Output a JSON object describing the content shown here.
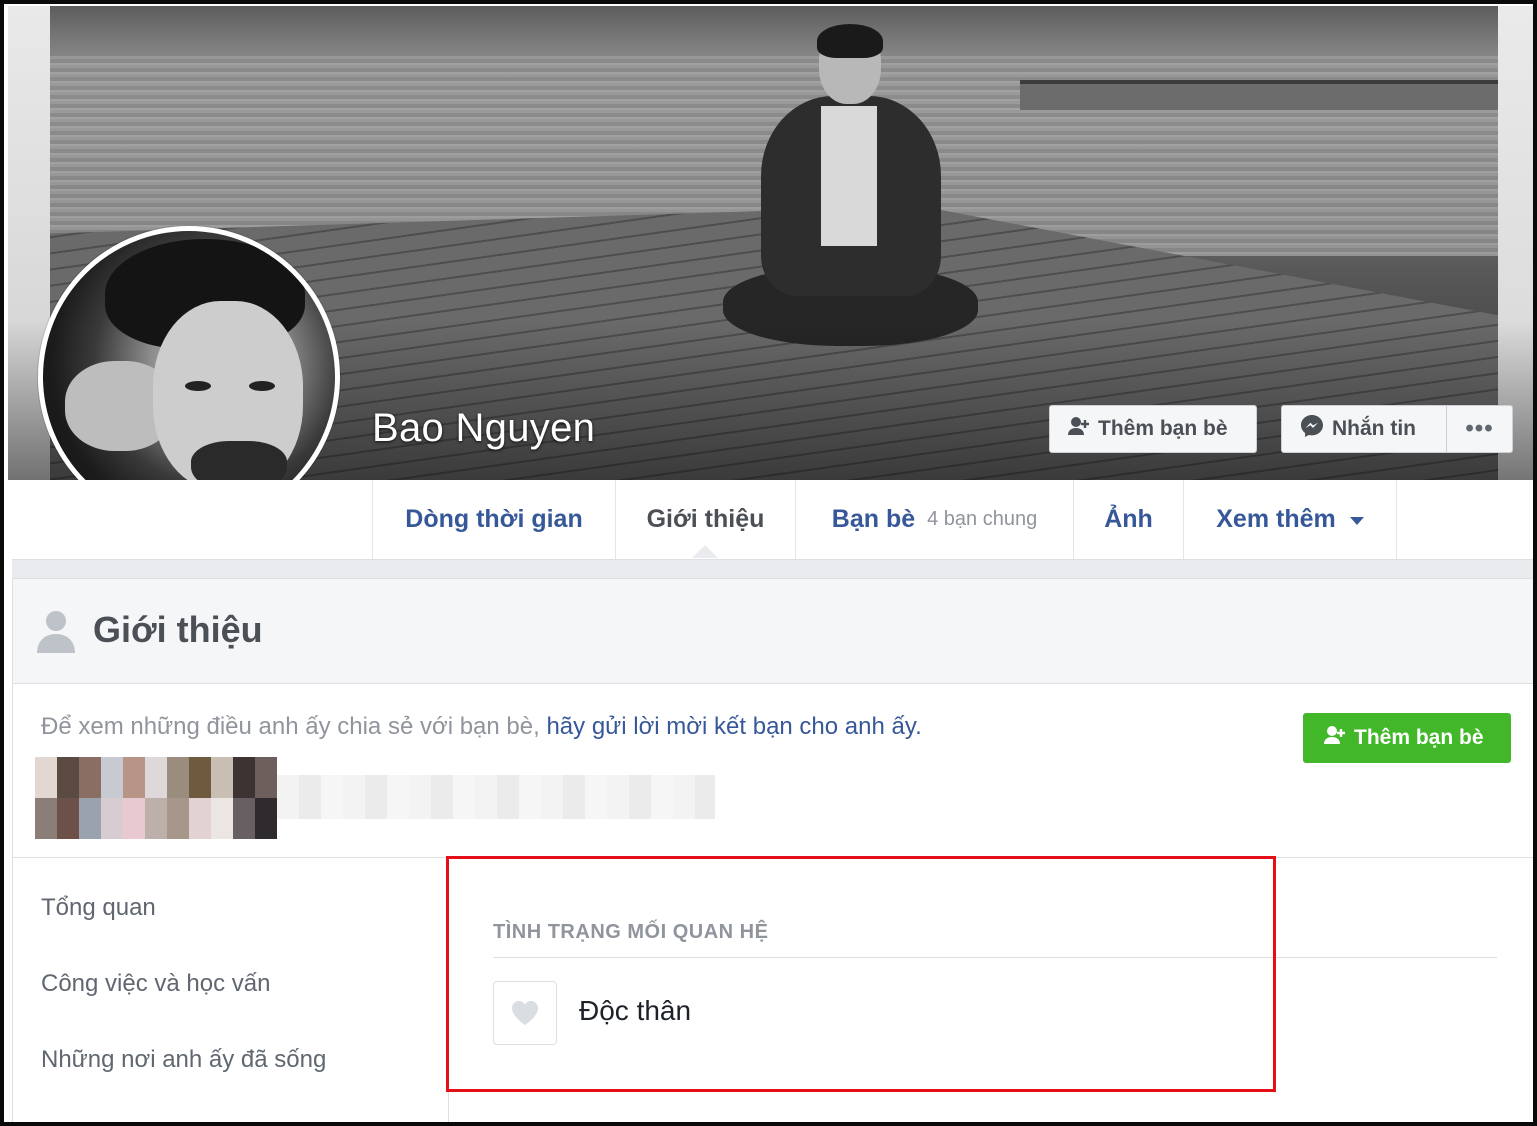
{
  "profile": {
    "name": "Bao Nguyen"
  },
  "cover_actions": {
    "add_friend_label": "Thêm bạn bè",
    "message_label": "Nhắn tin",
    "more_label": "•••"
  },
  "nav": {
    "tabs": [
      {
        "label": "Dòng thời gian"
      },
      {
        "label": "Giới thiệu",
        "active": true
      },
      {
        "label": "Bạn bè",
        "sub": "4 bạn chung"
      },
      {
        "label": "Ảnh"
      },
      {
        "label": "Xem thêm"
      }
    ]
  },
  "about": {
    "title": "Giới thiệu",
    "hint_prefix": "Để xem những điều anh ấy chia sẻ với bạn bè,",
    "hint_link": "hãy gửi lời mời kết bạn cho anh ấy.",
    "add_friend_label": "Thêm bạn bè",
    "sidebar": [
      "Tổng quan",
      "Công việc và học vấn",
      "Những nơi anh ấy đã sống"
    ],
    "relationship": {
      "heading": "TÌNH TRẠNG MỐI QUAN HỆ",
      "value": "Độc thân"
    }
  },
  "colors": {
    "link": "#365899",
    "green": "#42b72a",
    "highlight": "#e3101a"
  },
  "icons": {
    "add_friend": "add-friend-icon",
    "messenger": "messenger-icon",
    "person": "person-icon",
    "heart": "heart-icon",
    "dropdown": "chevron-down-icon"
  }
}
